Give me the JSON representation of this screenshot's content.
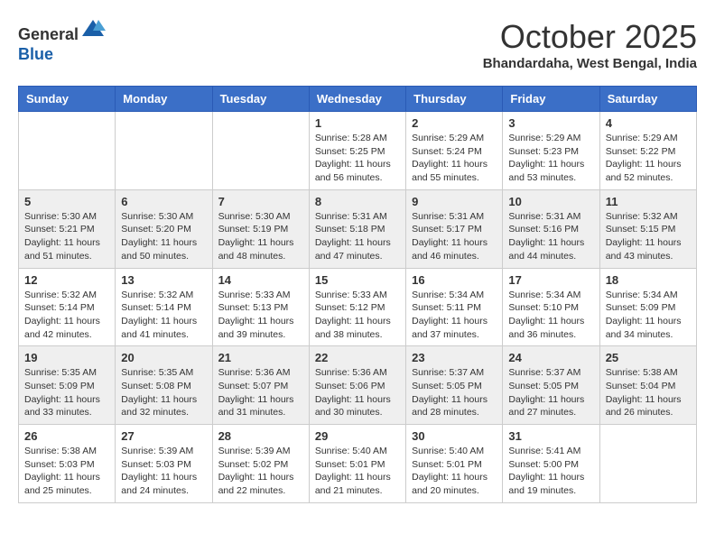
{
  "header": {
    "logo_line1": "General",
    "logo_line2": "Blue",
    "month_title": "October 2025",
    "location": "Bhandardaha, West Bengal, India"
  },
  "columns": [
    "Sunday",
    "Monday",
    "Tuesday",
    "Wednesday",
    "Thursday",
    "Friday",
    "Saturday"
  ],
  "weeks": [
    [
      {
        "day": "",
        "text": ""
      },
      {
        "day": "",
        "text": ""
      },
      {
        "day": "",
        "text": ""
      },
      {
        "day": "1",
        "text": "Sunrise: 5:28 AM\nSunset: 5:25 PM\nDaylight: 11 hours and 56 minutes."
      },
      {
        "day": "2",
        "text": "Sunrise: 5:29 AM\nSunset: 5:24 PM\nDaylight: 11 hours and 55 minutes."
      },
      {
        "day": "3",
        "text": "Sunrise: 5:29 AM\nSunset: 5:23 PM\nDaylight: 11 hours and 53 minutes."
      },
      {
        "day": "4",
        "text": "Sunrise: 5:29 AM\nSunset: 5:22 PM\nDaylight: 11 hours and 52 minutes."
      }
    ],
    [
      {
        "day": "5",
        "text": "Sunrise: 5:30 AM\nSunset: 5:21 PM\nDaylight: 11 hours and 51 minutes."
      },
      {
        "day": "6",
        "text": "Sunrise: 5:30 AM\nSunset: 5:20 PM\nDaylight: 11 hours and 50 minutes."
      },
      {
        "day": "7",
        "text": "Sunrise: 5:30 AM\nSunset: 5:19 PM\nDaylight: 11 hours and 48 minutes."
      },
      {
        "day": "8",
        "text": "Sunrise: 5:31 AM\nSunset: 5:18 PM\nDaylight: 11 hours and 47 minutes."
      },
      {
        "day": "9",
        "text": "Sunrise: 5:31 AM\nSunset: 5:17 PM\nDaylight: 11 hours and 46 minutes."
      },
      {
        "day": "10",
        "text": "Sunrise: 5:31 AM\nSunset: 5:16 PM\nDaylight: 11 hours and 44 minutes."
      },
      {
        "day": "11",
        "text": "Sunrise: 5:32 AM\nSunset: 5:15 PM\nDaylight: 11 hours and 43 minutes."
      }
    ],
    [
      {
        "day": "12",
        "text": "Sunrise: 5:32 AM\nSunset: 5:14 PM\nDaylight: 11 hours and 42 minutes."
      },
      {
        "day": "13",
        "text": "Sunrise: 5:32 AM\nSunset: 5:14 PM\nDaylight: 11 hours and 41 minutes."
      },
      {
        "day": "14",
        "text": "Sunrise: 5:33 AM\nSunset: 5:13 PM\nDaylight: 11 hours and 39 minutes."
      },
      {
        "day": "15",
        "text": "Sunrise: 5:33 AM\nSunset: 5:12 PM\nDaylight: 11 hours and 38 minutes."
      },
      {
        "day": "16",
        "text": "Sunrise: 5:34 AM\nSunset: 5:11 PM\nDaylight: 11 hours and 37 minutes."
      },
      {
        "day": "17",
        "text": "Sunrise: 5:34 AM\nSunset: 5:10 PM\nDaylight: 11 hours and 36 minutes."
      },
      {
        "day": "18",
        "text": "Sunrise: 5:34 AM\nSunset: 5:09 PM\nDaylight: 11 hours and 34 minutes."
      }
    ],
    [
      {
        "day": "19",
        "text": "Sunrise: 5:35 AM\nSunset: 5:09 PM\nDaylight: 11 hours and 33 minutes."
      },
      {
        "day": "20",
        "text": "Sunrise: 5:35 AM\nSunset: 5:08 PM\nDaylight: 11 hours and 32 minutes."
      },
      {
        "day": "21",
        "text": "Sunrise: 5:36 AM\nSunset: 5:07 PM\nDaylight: 11 hours and 31 minutes."
      },
      {
        "day": "22",
        "text": "Sunrise: 5:36 AM\nSunset: 5:06 PM\nDaylight: 11 hours and 30 minutes."
      },
      {
        "day": "23",
        "text": "Sunrise: 5:37 AM\nSunset: 5:05 PM\nDaylight: 11 hours and 28 minutes."
      },
      {
        "day": "24",
        "text": "Sunrise: 5:37 AM\nSunset: 5:05 PM\nDaylight: 11 hours and 27 minutes."
      },
      {
        "day": "25",
        "text": "Sunrise: 5:38 AM\nSunset: 5:04 PM\nDaylight: 11 hours and 26 minutes."
      }
    ],
    [
      {
        "day": "26",
        "text": "Sunrise: 5:38 AM\nSunset: 5:03 PM\nDaylight: 11 hours and 25 minutes."
      },
      {
        "day": "27",
        "text": "Sunrise: 5:39 AM\nSunset: 5:03 PM\nDaylight: 11 hours and 24 minutes."
      },
      {
        "day": "28",
        "text": "Sunrise: 5:39 AM\nSunset: 5:02 PM\nDaylight: 11 hours and 22 minutes."
      },
      {
        "day": "29",
        "text": "Sunrise: 5:40 AM\nSunset: 5:01 PM\nDaylight: 11 hours and 21 minutes."
      },
      {
        "day": "30",
        "text": "Sunrise: 5:40 AM\nSunset: 5:01 PM\nDaylight: 11 hours and 20 minutes."
      },
      {
        "day": "31",
        "text": "Sunrise: 5:41 AM\nSunset: 5:00 PM\nDaylight: 11 hours and 19 minutes."
      },
      {
        "day": "",
        "text": ""
      }
    ]
  ]
}
